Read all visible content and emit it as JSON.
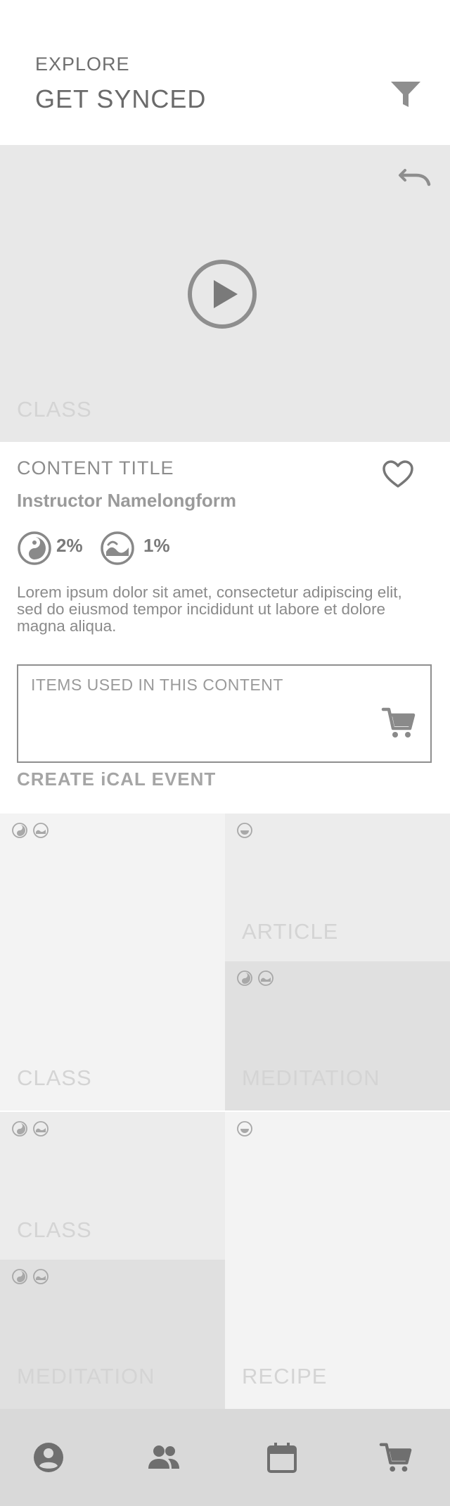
{
  "header": {
    "section_label": "EXPLORE",
    "title": "GET SYNCED",
    "filter_icon": "filter-icon"
  },
  "hero": {
    "label": "CLASS",
    "undo_icon": "undo-icon",
    "play_icon": "play-icon"
  },
  "detail": {
    "content_title": "CONTENT TITLE",
    "instructor": "Instructor Namelongform",
    "stats": [
      {
        "icon": "yin-yang-icon",
        "value": "2%"
      },
      {
        "icon": "wave-icon",
        "value": "1%"
      }
    ],
    "description": "Lorem ipsum dolor sit amet, consectetur adipiscing elit, sed do eiusmod tempor incididunt ut labore et dolore magna aliqua.",
    "items_label": "ITEMS USED IN THIS CONTENT",
    "ical_label": "CREATE iCAL EVENT"
  },
  "tiles": [
    {
      "label": "CLASS",
      "icons": [
        "yin-yang-icon",
        "wave-icon"
      ],
      "background": "#f3f3f3"
    },
    {
      "label": "ARTICLE",
      "icons": [
        "smile-icon"
      ],
      "background": "#ececec"
    },
    {
      "label": "MEDITATION",
      "icons": [
        "yin-yang-icon",
        "wave-icon"
      ],
      "background": "#e0e0e0"
    },
    {
      "label": "CLASS",
      "icons": [
        "yin-yang-icon",
        "wave-icon"
      ],
      "background": "#ececec"
    },
    {
      "label": "RECIPE",
      "icons": [
        "smile-icon"
      ],
      "background": "#f3f3f3"
    },
    {
      "label": "MEDITATION",
      "icons": [
        "yin-yang-icon",
        "wave-icon"
      ],
      "background": "#e0e0e0"
    }
  ],
  "bottom_nav": [
    {
      "name": "nav-profile",
      "icon": "user-icon"
    },
    {
      "name": "nav-community",
      "icon": "people-icon"
    },
    {
      "name": "nav-calendar",
      "icon": "calendar-icon"
    },
    {
      "name": "nav-cart",
      "icon": "cart-icon"
    }
  ]
}
